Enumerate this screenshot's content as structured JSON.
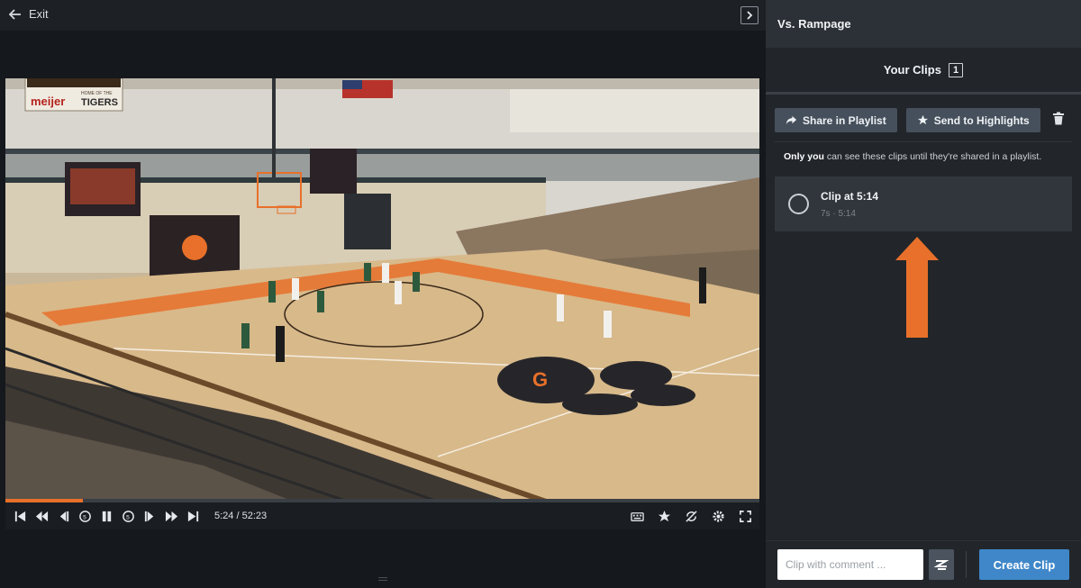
{
  "topbar": {
    "exit_label": "Exit"
  },
  "player": {
    "timecode": "5:24 / 52:23",
    "progress_fraction": 0.103,
    "scene": {
      "scoreboard_brand": "meijer",
      "scoreboard_home_of": "HOME OF THE",
      "scoreboard_team": "TIGERS",
      "floor_logo": "G"
    },
    "icons": [
      "skip-start-icon",
      "rewind-icon",
      "step-back-icon",
      "back-5-icon",
      "pause-icon",
      "forward-5-icon",
      "step-forward-icon",
      "fast-forward-icon",
      "skip-end-icon",
      "keyboard-icon",
      "highlight-icon",
      "no-loop-icon",
      "settings-icon",
      "fullscreen-icon"
    ]
  },
  "sidebar": {
    "title": "Vs. Rampage",
    "clips_tab_label": "Your Clips",
    "clips_count": "1",
    "share_label": "Share in Playlist",
    "highlights_label": "Send to Highlights",
    "notice_bold": "Only you",
    "notice_rest": " can see these clips until they're shared in a playlist.",
    "clips": [
      {
        "title": "Clip at 5:14",
        "duration": "7s",
        "separator": "·",
        "time": "5:14"
      }
    ],
    "comment_placeholder": "Clip with comment ...",
    "create_label": "Create Clip"
  },
  "colors": {
    "accent": "#e8702a",
    "primary_button": "#3f87c9",
    "panel": "#22262b"
  }
}
